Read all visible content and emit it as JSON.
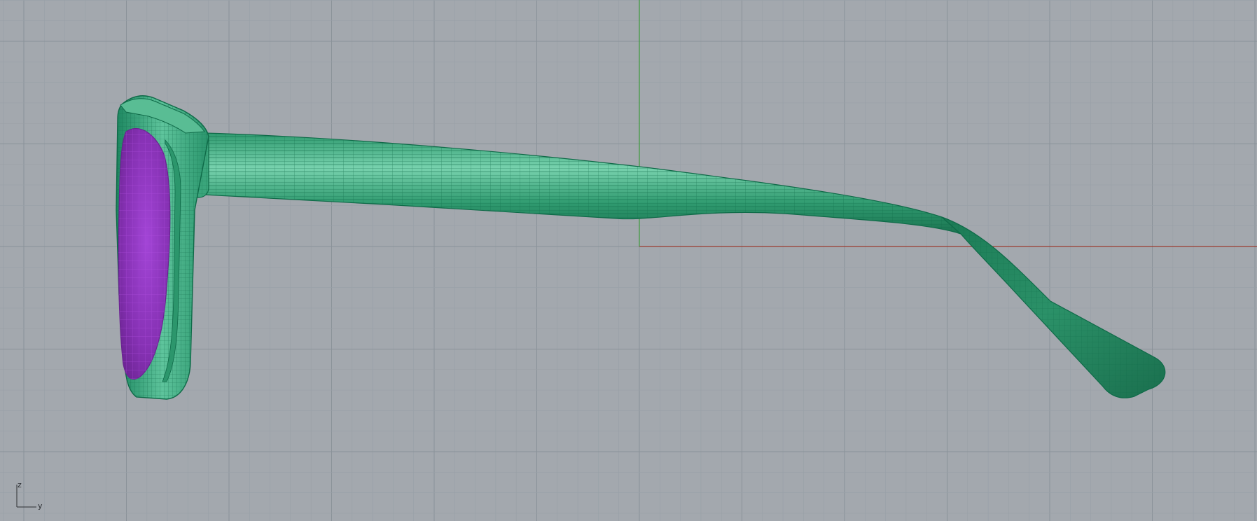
{
  "viewport": {
    "background_color": "#a3a8ae",
    "grid_minor_color": "#98a0a7",
    "grid_major_color": "#8a9299",
    "x_axis_color": "#9c3b30",
    "z_axis_color": "#3e9a3e"
  },
  "model": {
    "frame_color": "#1f8a63",
    "frame_highlight_color": "#6fcfa7",
    "frame_wire_color": "#0f6a48",
    "lens_color": "#8a36b8",
    "lens_wire_color": "#b24fe0"
  },
  "axis_gizmo": {
    "vertical_label": "z",
    "horizontal_label": "y"
  }
}
